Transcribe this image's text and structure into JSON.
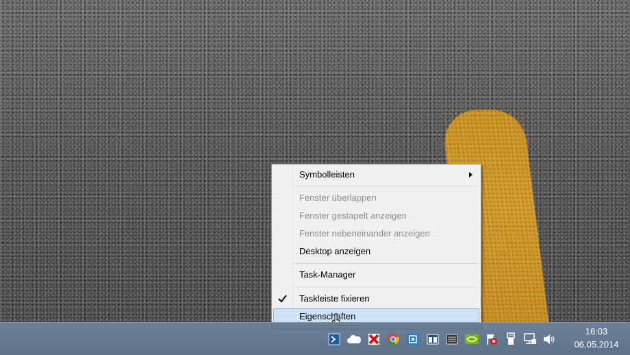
{
  "context_menu": {
    "items": [
      {
        "label": "Symbolleisten"
      },
      {
        "label": "Fenster überlappen"
      },
      {
        "label": "Fenster gestapelt anzeigen"
      },
      {
        "label": "Fenster nebeneinander anzeigen"
      },
      {
        "label": "Desktop anzeigen"
      },
      {
        "label": "Task-Manager"
      },
      {
        "label": "Taskleiste fixieren"
      },
      {
        "label": "Eigenschaften"
      }
    ]
  },
  "tray": {
    "icons": [
      "powershell-icon",
      "cloud-icon",
      "antivirus-icon",
      "chrome-icon",
      "network-app-icon",
      "window-app-icon",
      "list-app-icon",
      "nvidia-icon",
      "action-center-flag-icon",
      "usb-icon",
      "network-icon",
      "volume-icon"
    ]
  },
  "clock": {
    "time": "16:03",
    "date": "06.05.2014"
  },
  "colors": {
    "menu_background": "#f0f0f0",
    "menu_hover": "#cfe3f7",
    "taskbar": "#5b7490",
    "road_line": "#e0a42a"
  }
}
